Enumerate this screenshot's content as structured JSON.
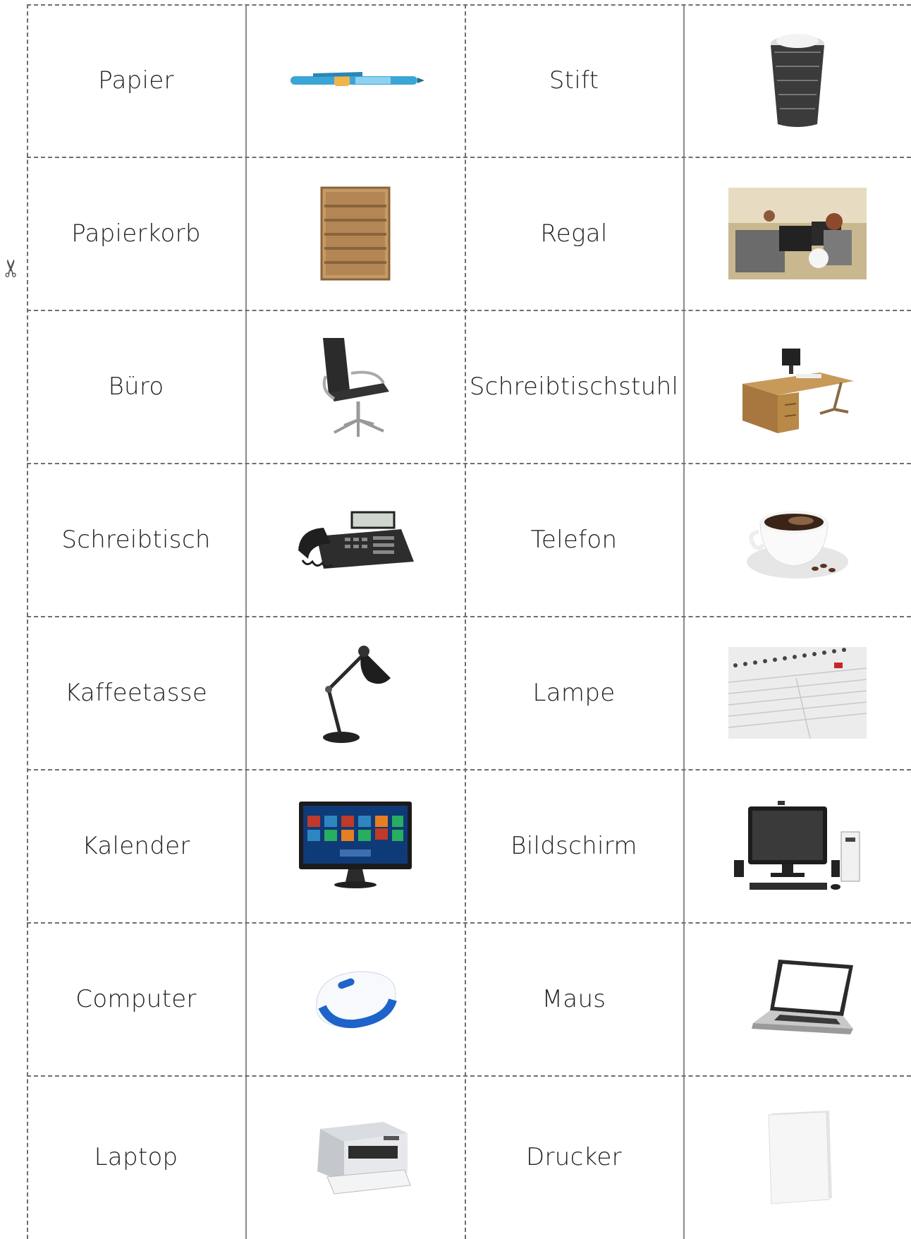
{
  "rows": [
    {
      "left_word": "Papier",
      "left_icon": "pen-icon",
      "right_word": "Stift",
      "right_icon": "wastebasket-icon"
    },
    {
      "left_word": "Papierkorb",
      "left_icon": "shelf-icon",
      "right_word": "Regal",
      "right_icon": "office-photo-icon"
    },
    {
      "left_word": "Büro",
      "left_icon": "office-chair-icon",
      "right_word": "Schreibtischstuhl",
      "right_icon": "desk-icon"
    },
    {
      "left_word": "Schreibtisch",
      "left_icon": "telephone-icon",
      "right_word": "Telefon",
      "right_icon": "coffee-cup-icon"
    },
    {
      "left_word": "Kaffeetasse",
      "left_icon": "desk-lamp-icon",
      "right_word": "Lampe",
      "right_icon": "calendar-icon"
    },
    {
      "left_word": "Kalender",
      "left_icon": "monitor-icon",
      "right_word": "Bildschirm",
      "right_icon": "computer-icon"
    },
    {
      "left_word": "Computer",
      "left_icon": "mouse-icon",
      "right_word": "Maus",
      "right_icon": "laptop-icon"
    },
    {
      "left_word": "Laptop",
      "left_icon": "printer-icon",
      "right_word": "Drucker",
      "right_icon": "paper-stack-icon"
    }
  ]
}
